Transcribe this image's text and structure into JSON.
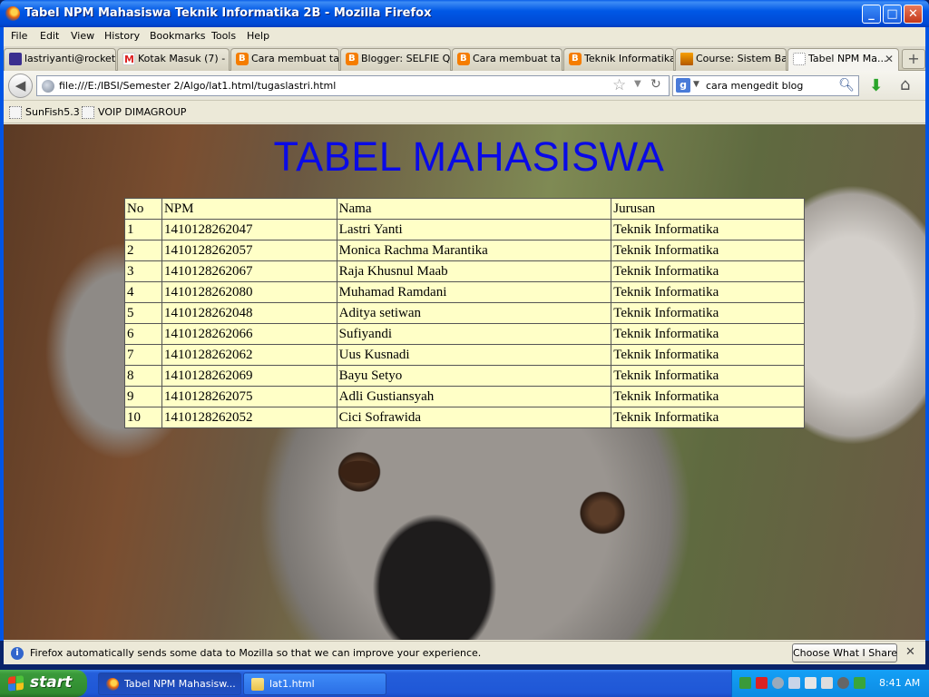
{
  "window": {
    "title": "Tabel NPM Mahasiswa Teknik Informatika 2B - Mozilla Firefox",
    "minimize": "_",
    "maximize": "□",
    "close": "✕"
  },
  "menu": {
    "file": "File",
    "edit": "Edit",
    "view": "View",
    "history": "History",
    "bookmarks": "Bookmarks",
    "tools": "Tools",
    "help": "Help"
  },
  "tabs": [
    {
      "label": "lastriyanti@rocket...",
      "icon": "mail-icon"
    },
    {
      "label": "Kotak Masuk (7) - ...",
      "icon": "gmail-icon"
    },
    {
      "label": "Cara membuat ta...",
      "icon": "blogger-icon"
    },
    {
      "label": "Blogger: SELFIE Q...",
      "icon": "blogger-icon"
    },
    {
      "label": "Cara membuat ta...",
      "icon": "blogger-icon"
    },
    {
      "label": "Teknik Informatika",
      "icon": "blogger-icon"
    },
    {
      "label": "Course: Sistem Ba...",
      "icon": "course-icon"
    },
    {
      "label": "Tabel NPM Ma...",
      "icon": "blank-page-icon",
      "active": true
    }
  ],
  "new_tab": "+",
  "tab_close": "✕",
  "nav": {
    "back": "◀",
    "url": "file:///E:/IBSI/Semester 2/Algo/lat1.html/tugaslastri.html",
    "search_engine": "g",
    "search_text": "cara mengedit blog"
  },
  "bookmarks": [
    {
      "label": "SunFish5.3"
    },
    {
      "label": "VOIP DIMAGROUP"
    }
  ],
  "page": {
    "heading": "TABEL MAHASISWA",
    "columns": [
      "No",
      "NPM",
      "Nama",
      "Jurusan"
    ],
    "rows": [
      [
        "1",
        "1410128262047",
        "Lastri Yanti",
        "Teknik Informatika"
      ],
      [
        "2",
        "1410128262057",
        "Monica Rachma Marantika",
        "Teknik Informatika"
      ],
      [
        "3",
        "1410128262067",
        "Raja Khusnul Maab",
        "Teknik Informatika"
      ],
      [
        "4",
        "1410128262080",
        "Muhamad Ramdani",
        "Teknik Informatika"
      ],
      [
        "5",
        "1410128262048",
        "Aditya setiwan",
        "Teknik Informatika"
      ],
      [
        "6",
        "1410128262066",
        "Sufiyandi",
        "Teknik Informatika"
      ],
      [
        "7",
        "1410128262062",
        "Uus Kusnadi",
        "Teknik Informatika"
      ],
      [
        "8",
        "1410128262069",
        "Bayu Setyo",
        "Teknik Informatika"
      ],
      [
        "9",
        "1410128262075",
        "Adli Gustiansyah",
        "Teknik Informatika"
      ],
      [
        "10",
        "1410128262052",
        "Cici Sofrawida",
        "Teknik Informatika"
      ]
    ]
  },
  "notification": {
    "icon": "i",
    "text": "Firefox automatically sends some data to Mozilla so that we can improve your experience.",
    "button": "Choose What I Share",
    "close": "✕"
  },
  "taskbar": {
    "start": "start",
    "items": [
      {
        "label": "Tabel NPM Mahasisw...",
        "icon": "firefox-icon",
        "active": true
      },
      {
        "label": "lat1.html",
        "icon": "folder-icon",
        "active": false
      }
    ],
    "clock": "8:41 AM"
  },
  "colors": {
    "heading": "#0a0ae6",
    "table_bg": "#ffffc7",
    "titlebar": "#0058e6",
    "start_green": "#3a9a3a"
  }
}
